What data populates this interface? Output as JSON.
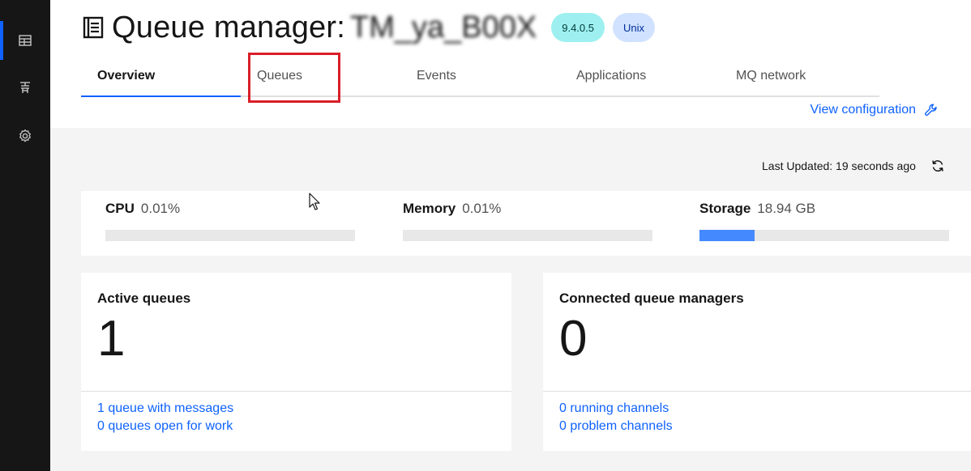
{
  "rail": {
    "items": [
      {
        "icon": "table-icon",
        "active": true
      },
      {
        "icon": "queue-manager-icon",
        "active": false
      },
      {
        "icon": "settings-gear-icon",
        "active": false
      }
    ]
  },
  "header": {
    "title": "Queue manager:",
    "qm_name": "TM_ya_B00X",
    "version_tag": "9.4.0.5",
    "platform_tag": "Unix",
    "view_config_label": "View configuration"
  },
  "tabs": [
    {
      "label": "Overview",
      "selected": true
    },
    {
      "label": "Queues",
      "selected": false
    },
    {
      "label": "Events",
      "selected": false
    },
    {
      "label": "Applications",
      "selected": false
    },
    {
      "label": "MQ network",
      "selected": false
    }
  ],
  "status": {
    "last_updated": "Last Updated: 19 seconds ago"
  },
  "usage": {
    "cpu": {
      "label": "CPU",
      "value": "0.01%",
      "fill_fraction": 0.0
    },
    "memory": {
      "label": "Memory",
      "value": "0.01%",
      "fill_fraction": 0.0
    },
    "storage": {
      "label": "Storage",
      "value": "18.94 GB",
      "fill_fraction": 0.22
    }
  },
  "tiles": {
    "active_queues": {
      "title": "Active queues",
      "count": "1",
      "link1": "1 queue with messages",
      "link2": "0 queues open for work"
    },
    "connected_qms": {
      "title": "Connected queue managers",
      "count": "0",
      "link1": "0 running channels",
      "link2": "0 problem channels"
    }
  },
  "colors": {
    "accent": "#0f62fe",
    "highlight": "#da1e28",
    "rail": "#161616"
  }
}
